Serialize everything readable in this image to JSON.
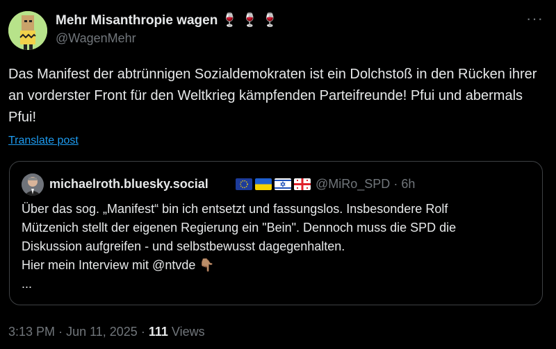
{
  "author": {
    "display_name": "Mehr Misanthropie wagen",
    "emojis": "🍷 🍷 🍷",
    "handle": "@WagenMehr"
  },
  "tweet": {
    "text": "Das Manifest der abtrünnigen Sozialdemokraten ist ein Dolchstoß in den Rücken ihrer an vorderster Front für den Weltkrieg kämpfenden Parteifreunde! Pfui und abermals Pfui!",
    "translate_label": "Translate post",
    "more_label": "···"
  },
  "quoted": {
    "display_name": "michaelroth.bluesky.social",
    "handle": "@MiRo_SPD",
    "time": "6h",
    "lines": [
      "Über das sog. „Manifest“ bin ich entsetzt und fassungslos. Insbesondere Rolf",
      "Mützenich stellt der eigenen Regierung ein \"Bein\". Dennoch muss die SPD die",
      "Diskussion aufgreifen - und selbstbewusst dagegenhalten.",
      "Hier mein Interview mit @ntvde 👇🏽",
      "..."
    ]
  },
  "footer": {
    "time": "3:13 PM",
    "date": "Jun 11, 2025",
    "views_count": "111",
    "views_label": "Views"
  },
  "colors": {
    "background": "#000000",
    "text": "#e7e9ea",
    "muted": "#71767b",
    "link": "#1d9bf0",
    "border": "#3e4144"
  }
}
